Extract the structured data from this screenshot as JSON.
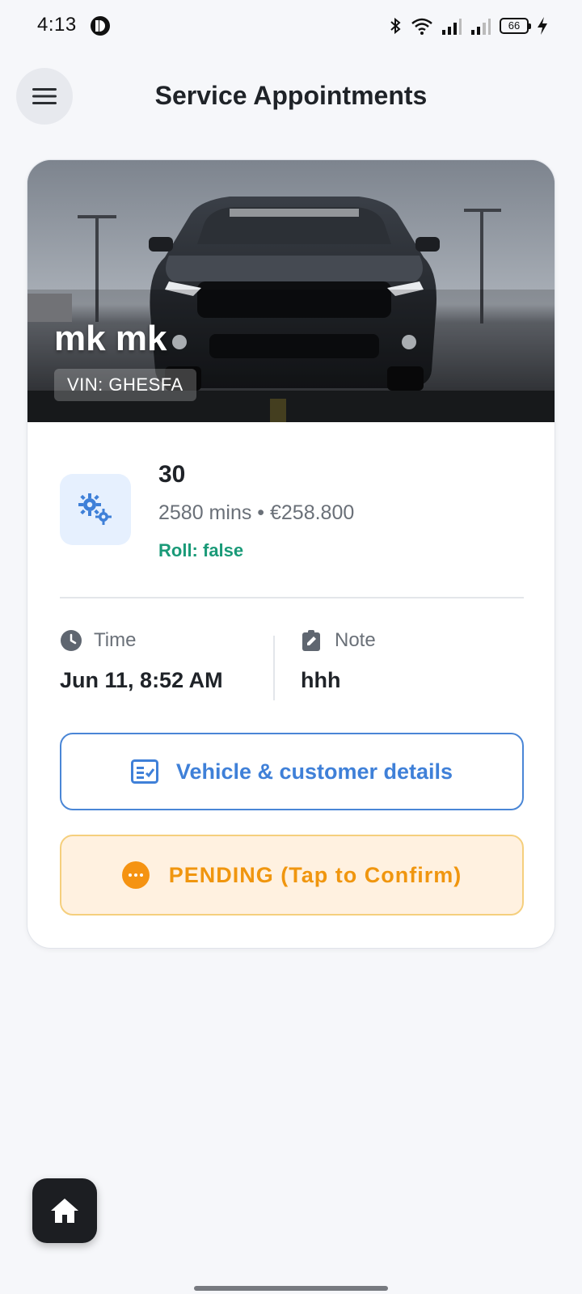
{
  "status_bar": {
    "time": "4:13",
    "battery": "66",
    "icons": [
      "app-icon",
      "bluetooth-icon",
      "wifi-icon",
      "signal-icon",
      "signal-icon-2",
      "battery-icon",
      "charging-icon"
    ]
  },
  "header": {
    "title": "Service Appointments",
    "menu_icon": "hamburger-menu-icon"
  },
  "appointment": {
    "vehicle_name": "mk mk",
    "vin": "VIN: GHESFA",
    "service": {
      "name": "30",
      "meta": "2580 mins • €258.800",
      "roll": "Roll: false",
      "icon": "gears-icon"
    },
    "time": {
      "label": "Time",
      "value": "Jun 11, 8:52 AM",
      "icon": "clock-icon"
    },
    "note": {
      "label": "Note",
      "value": "hhh",
      "icon": "edit-note-icon"
    },
    "details_button": {
      "label": "Vehicle & customer details",
      "icon": "checklist-icon"
    },
    "status_button": {
      "label": "PENDING (Tap to Confirm)",
      "icon": "more-dots-icon"
    }
  },
  "fab": {
    "icon": "home-icon"
  },
  "colors": {
    "accent_blue": "#3f80d8",
    "pending_orange": "#f0960f",
    "pending_bg": "#fff1e0",
    "roll_green": "#1a9a78",
    "background": "#f6f7fa"
  }
}
